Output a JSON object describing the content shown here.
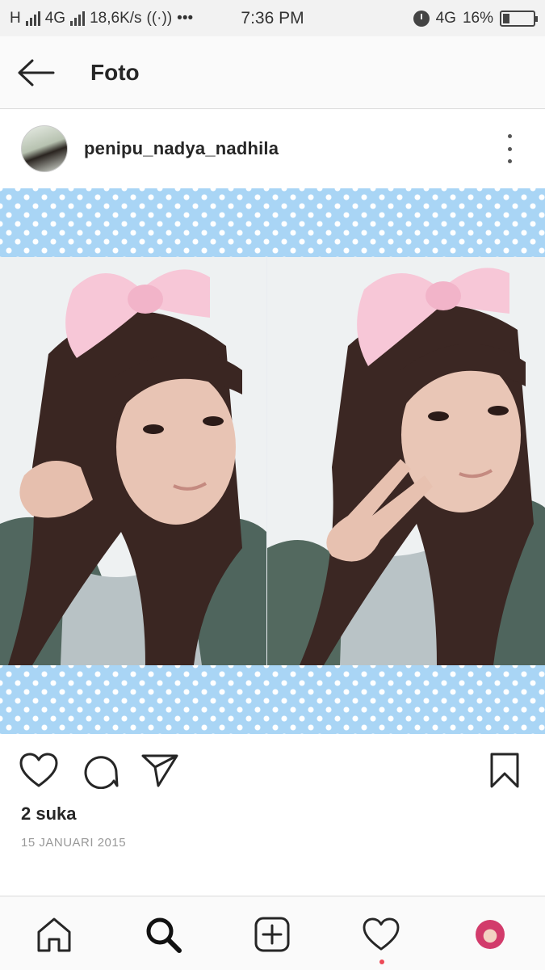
{
  "status_bar": {
    "network_type": "H",
    "network_4g": "4G",
    "speed": "18,6K/s",
    "more": "•••",
    "time": "7:36 PM",
    "volte": "4G",
    "battery": "16%"
  },
  "header": {
    "title": "Foto"
  },
  "post": {
    "username": "penipu_nadya_nadhila",
    "likes": "2 suka",
    "date": "15 JANUARI 2015"
  },
  "icons": {
    "back": "arrow-left-icon",
    "more": "more-vertical-icon",
    "like": "heart-icon",
    "comment": "comment-icon",
    "share": "send-icon",
    "save": "bookmark-icon",
    "home": "home-icon",
    "search": "search-icon",
    "new_post": "plus-square-icon",
    "activity": "heart-icon",
    "profile": "profile-avatar"
  },
  "colors": {
    "polka_blue": "#a9d5f5",
    "notification_dot": "#ed4956",
    "text_primary": "#262626",
    "text_secondary": "#999999"
  }
}
